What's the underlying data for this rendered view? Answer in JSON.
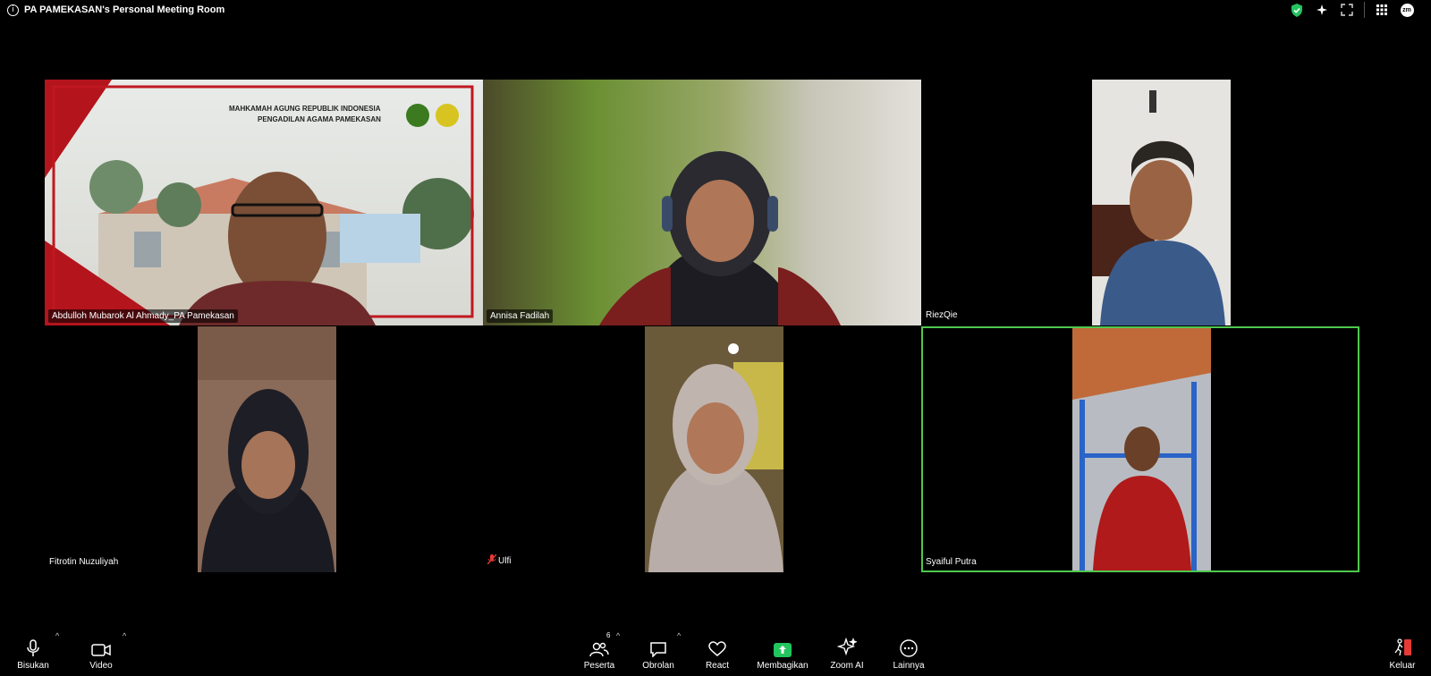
{
  "meeting": {
    "title": "PA PAMEKASAN's Personal Meeting Room"
  },
  "banner": {
    "line1": "MAHKAMAH AGUNG REPUBLIK INDONESIA",
    "line2": "PENGADILAN AGAMA PAMEKASAN"
  },
  "participants": [
    {
      "name": "Abdulloh Mubarok Al Ahmady_PA Pamekasan",
      "muted": false
    },
    {
      "name": "Annisa Fadilah",
      "muted": false
    },
    {
      "name": "RiezQie",
      "muted": false
    },
    {
      "name": "Fitrotin Nuzuliyah",
      "muted": false
    },
    {
      "name": "Ulfi",
      "muted": true
    },
    {
      "name": "Syaiful Putra",
      "muted": false,
      "active_speaker": true
    }
  ],
  "toolbar": {
    "mute": "Bisukan",
    "video": "Video",
    "participants": "Peserta",
    "participants_count": "6",
    "chat": "Obrolan",
    "react": "React",
    "share": "Membagikan",
    "zoom_ai": "Zoom AI",
    "more": "Lainnya",
    "leave": "Keluar"
  },
  "colors": {
    "active_speaker_border": "#4ec94e",
    "share_green": "#22c55e",
    "mute_red": "#e53935",
    "leave_red": "#e53935"
  },
  "icons": [
    "info-icon",
    "shield-icon",
    "sparkle-icon",
    "fullscreen-icon",
    "grid-icon",
    "avatar-icon",
    "mic-icon",
    "video-camera-icon",
    "participants-icon",
    "chat-icon",
    "heart-icon",
    "share-icon",
    "zoom-ai-icon",
    "more-icon",
    "leave-icon"
  ]
}
